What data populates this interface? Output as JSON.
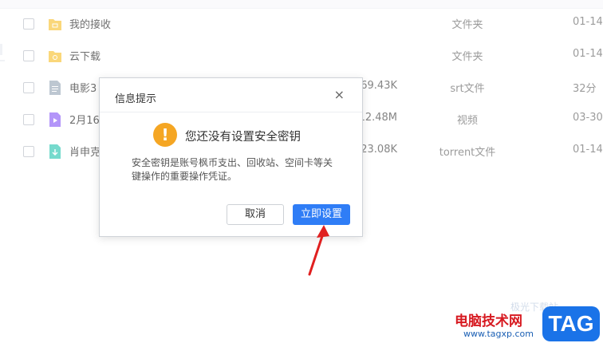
{
  "files": [
    {
      "name": "我的接收",
      "size": "",
      "type": "文件夹",
      "date": "01-14",
      "icon": "folder-inbox-icon",
      "color": "#f7c234"
    },
    {
      "name": "云下载",
      "size": "",
      "type": "文件夹",
      "date": "01-14",
      "icon": "folder-cloud-icon",
      "color": "#f7c234"
    },
    {
      "name": "电影3",
      "size": "69.43K",
      "type": "srt文件",
      "date": "32分",
      "icon": "text-file-icon",
      "color": "#9aa9b8"
    },
    {
      "name": "2月16",
      "size": "12.48M",
      "type": "视频",
      "date": "03-30",
      "icon": "video-file-icon",
      "color": "#8b5cf6"
    },
    {
      "name": "肖申克",
      "size": "23.08K",
      "type": "torrent文件",
      "date": "01-14",
      "icon": "torrent-file-icon",
      "color": "#2dc7b3"
    }
  ],
  "dialog": {
    "title": "信息提示",
    "close": "×",
    "heading": "您还没有设置安全密钥",
    "body": "安全密钥是账号枫币支出、回收站、空间卡等关键操作的重要操作凭证。",
    "cancel_label": "取消",
    "confirm_label": "立即设置",
    "warning_glyph": "!",
    "accent": "#2f7df6",
    "warning_color": "#f5a623"
  },
  "watermark": {
    "faint": "极光下载站",
    "site": "电脑技术网",
    "url": "www.tagxp.com",
    "tag": "TAG"
  }
}
